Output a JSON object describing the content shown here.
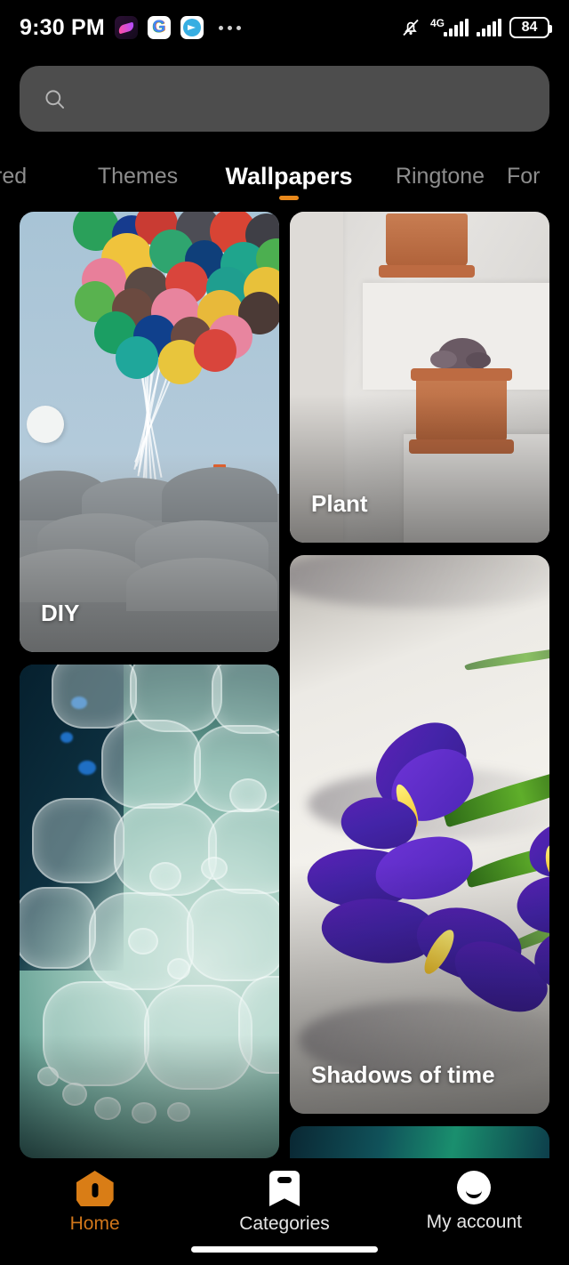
{
  "status_bar": {
    "time": "9:30 PM",
    "notification_icons": [
      "music-app-icon",
      "google-icon",
      "telegram-icon"
    ],
    "overflow": "more-notifications-icon",
    "silent_icon": "bell-muted-icon",
    "network_type": "4G",
    "battery_percent": "84"
  },
  "search": {
    "icon": "search-icon",
    "value": "",
    "placeholder": ""
  },
  "tabs": [
    {
      "label": "red",
      "active": false
    },
    {
      "label": "Themes",
      "active": false
    },
    {
      "label": "Wallpapers",
      "active": true
    },
    {
      "label": "Ringtone",
      "active": false
    },
    {
      "label": "For",
      "active": false
    }
  ],
  "accent_color": "#e8881b",
  "wallpapers": {
    "left_column": [
      {
        "title": "DIY",
        "art": "balloons-house"
      },
      {
        "title": "",
        "art": "soap-bubbles"
      }
    ],
    "right_column": [
      {
        "title": "Plant",
        "art": "terracotta-pots"
      },
      {
        "title": "Shadows of time",
        "art": "purple-iris"
      },
      {
        "title": "",
        "art": "teal-gradient"
      }
    ]
  },
  "bottom_nav": [
    {
      "label": "Home",
      "icon": "home-icon",
      "active": true
    },
    {
      "label": "Categories",
      "icon": "bookmark-icon",
      "active": false
    },
    {
      "label": "My account",
      "icon": "account-face-icon",
      "active": false
    }
  ]
}
